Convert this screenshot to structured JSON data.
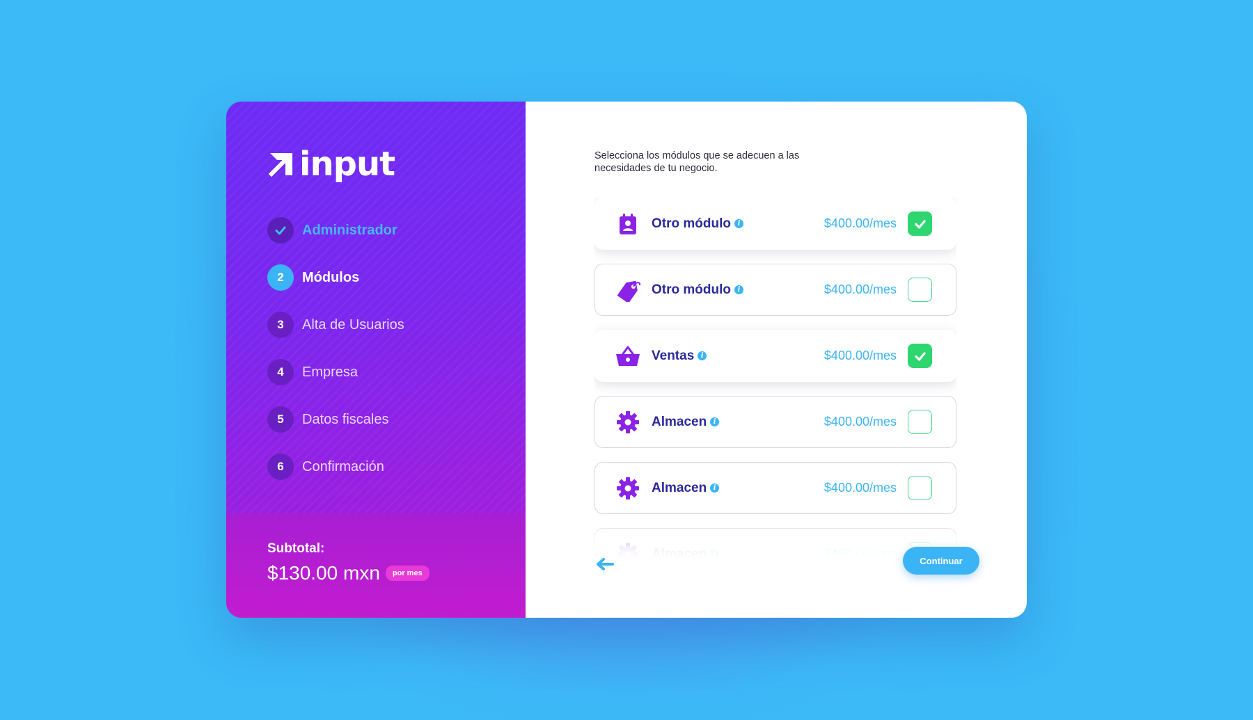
{
  "brand": {
    "name": "input"
  },
  "steps": [
    {
      "number": "1",
      "label": "Administrador",
      "state": "done",
      "icon": "check-icon"
    },
    {
      "number": "2",
      "label": "Módulos",
      "state": "active"
    },
    {
      "number": "3",
      "label": "Alta de Usuarios",
      "state": "pending"
    },
    {
      "number": "4",
      "label": "Empresa",
      "state": "pending"
    },
    {
      "number": "5",
      "label": "Datos fiscales",
      "state": "pending"
    },
    {
      "number": "6",
      "label": "Confirmación",
      "state": "pending"
    }
  ],
  "subtotal": {
    "title": "Subtotal:",
    "amount": "$130.00 mxn",
    "period_badge": "por mes"
  },
  "main": {
    "intro": "Selecciona los módulos que se adecuen a las necesidades de tu negocio.",
    "modules": [
      {
        "name": "Otro módulo",
        "price": "$400.00/mes",
        "checked": true,
        "icon": "contact-book-icon"
      },
      {
        "name": "Otro módulo",
        "price": "$400.00/mes",
        "checked": false,
        "icon": "price-tag-icon"
      },
      {
        "name": "Ventas",
        "price": "$400.00/mes",
        "checked": true,
        "icon": "shopping-basket-icon"
      },
      {
        "name": "Almacen",
        "price": "$400.00/mes",
        "checked": false,
        "icon": "gear-icon"
      },
      {
        "name": "Almacen",
        "price": "$400.00/mes",
        "checked": false,
        "icon": "gear-icon"
      },
      {
        "name": "Almacen",
        "price": "$400.00/mes",
        "checked": false,
        "icon": "gear-icon"
      }
    ],
    "continue_label": "Continuar"
  },
  "colors": {
    "accent_blue": "#3bb4f5",
    "purple": "#7a27ef",
    "magenta": "#c21ccf",
    "check_green": "#2ed66f",
    "module_name": "#2b2a9a"
  }
}
